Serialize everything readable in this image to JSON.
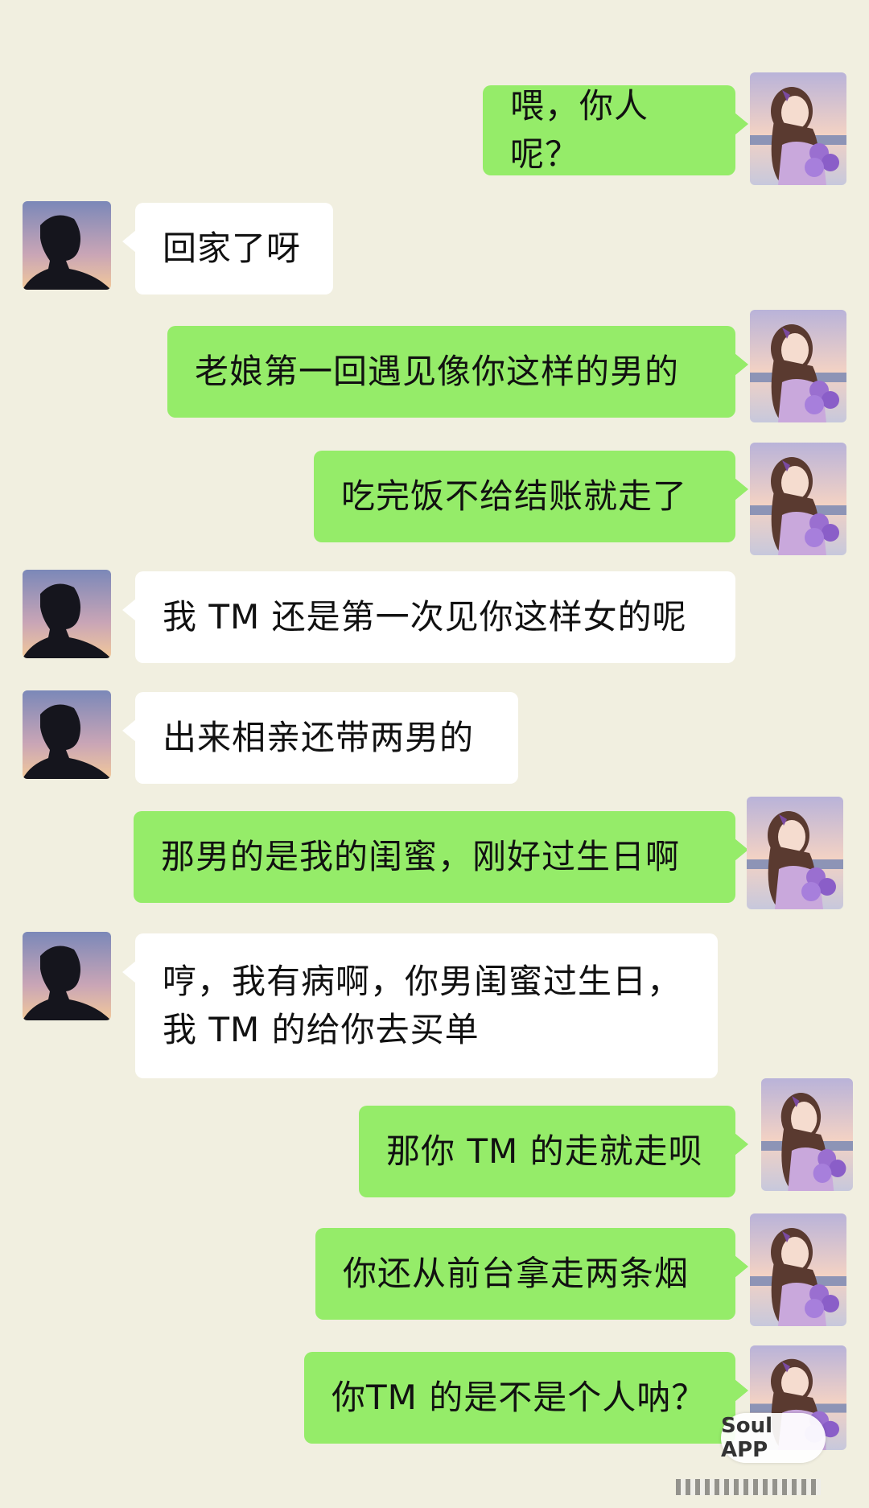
{
  "messages": [
    {
      "side": "right",
      "text": "喂，你人呢？"
    },
    {
      "side": "left",
      "text": "回家了呀"
    },
    {
      "side": "right",
      "text": "老娘第一回遇见像你这样的男的"
    },
    {
      "side": "right",
      "text": "吃完饭不给结账就走了"
    },
    {
      "side": "left",
      "text": "我 TM 还是第一次见你这样女的呢"
    },
    {
      "side": "left",
      "text": "出来相亲还带两男的"
    },
    {
      "side": "right",
      "text": "那男的是我的闺蜜，刚好过生日啊"
    },
    {
      "side": "left",
      "line1": "哼，我有病啊，你男闺蜜过生日，",
      "line2": "我 TM 的给你去买单"
    },
    {
      "side": "right",
      "text": "那你 TM 的走就走呗"
    },
    {
      "side": "right",
      "text": "你还从前台拿走两条烟"
    },
    {
      "side": "right",
      "text": "你TM 的是不是个人呐？"
    }
  ],
  "watermark": "Soul APP",
  "colors": {
    "background": "#f1efe0",
    "sent_bubble": "#95ec69",
    "received_bubble": "#ffffff"
  },
  "icons": {
    "left_avatar": "male-silhouette-avatar-icon",
    "right_avatar": "girl-with-flowers-avatar-icon"
  }
}
